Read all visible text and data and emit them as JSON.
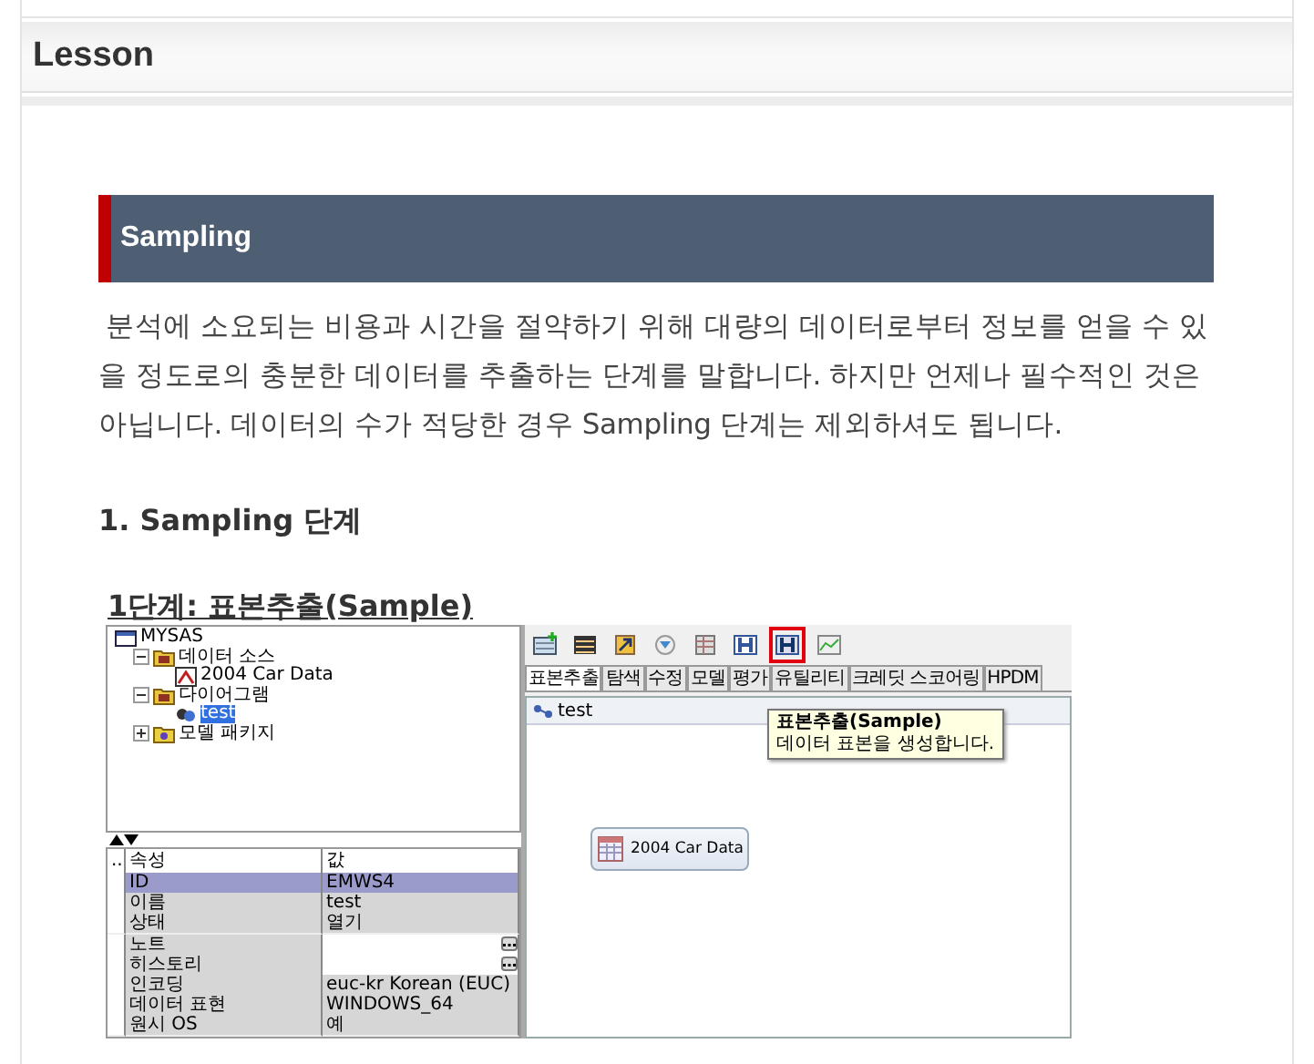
{
  "page": {
    "title": "Lesson"
  },
  "section": {
    "title": "Sampling",
    "paragraph": "분석에 소요되는 비용과 시간을 절약하기 위해 대량의 데이터로부터 정보를 얻을 수 있을 정도로의 충분한 데이터를 추출하는 단계를 말합니다. 하지만 언제나 필수적인 것은 아닙니다. 데이터의 수가 적당한 경우 Sampling 단계는 제외하셔도 됩니다.",
    "heading": "1. Sampling 단계",
    "step_title": "1단계: 표본추출(Sample)"
  },
  "app": {
    "tree": [
      {
        "label": "MYSAS",
        "kind": "root",
        "selected": false,
        "children": [
          {
            "label": "데이터 소스",
            "kind": "folder",
            "selected": false,
            "expanded": true,
            "children": [
              {
                "label": "2004 Car Data",
                "kind": "data",
                "selected": false
              }
            ]
          },
          {
            "label": "다이어그램",
            "kind": "folder",
            "selected": false,
            "expanded": true,
            "children": [
              {
                "label": "test",
                "kind": "diagram",
                "selected": true
              }
            ]
          },
          {
            "label": "모델 패키지",
            "kind": "package",
            "selected": false,
            "expanded": false
          }
        ]
      }
    ],
    "properties": {
      "columns": [
        "..",
        "속성",
        "값"
      ],
      "rows": [
        {
          "name": "ID",
          "value": "EMWS4",
          "kind": "text",
          "selected": true
        },
        {
          "name": "이름",
          "value": "test",
          "kind": "text",
          "selected": false
        },
        {
          "name": "상태",
          "value": "열기",
          "kind": "text",
          "selected": false
        },
        {
          "name": "노트",
          "kind": "editor",
          "selected": false
        },
        {
          "name": "히스토리",
          "kind": "editor",
          "selected": false
        },
        {
          "name": "인코딩",
          "value": "euc-kr  Korean (EUC)",
          "kind": "text",
          "selected": false
        },
        {
          "name": "데이터 표현",
          "value": "WINDOWS_64",
          "kind": "text",
          "selected": false
        },
        {
          "name": "원시 OS",
          "value": "예",
          "kind": "text",
          "selected": false
        }
      ]
    },
    "toolbar": [
      {
        "selected": false
      },
      {
        "selected": false
      },
      {
        "selected": false
      },
      {
        "selected": false
      },
      {
        "selected": false
      },
      {
        "selected": false
      },
      {
        "selected": true
      },
      {
        "selected": false
      }
    ],
    "tabs": [
      {
        "label": "표본추출",
        "selected": true
      },
      {
        "label": "탐색",
        "selected": false
      },
      {
        "label": "수정",
        "selected": false
      },
      {
        "label": "모델",
        "selected": false
      },
      {
        "label": "평가",
        "selected": false
      },
      {
        "label": "유틸리티",
        "selected": false
      },
      {
        "label": "크레딧 스코어링",
        "selected": false
      },
      {
        "label": "HPDM",
        "selected": false
      }
    ],
    "tooltip": {
      "title": "표본추출(Sample)",
      "text": "데이터 표본을 생성합니다."
    },
    "diagram": {
      "title": "test",
      "nodes": [
        {
          "label": "2004 Car Data"
        }
      ]
    }
  }
}
